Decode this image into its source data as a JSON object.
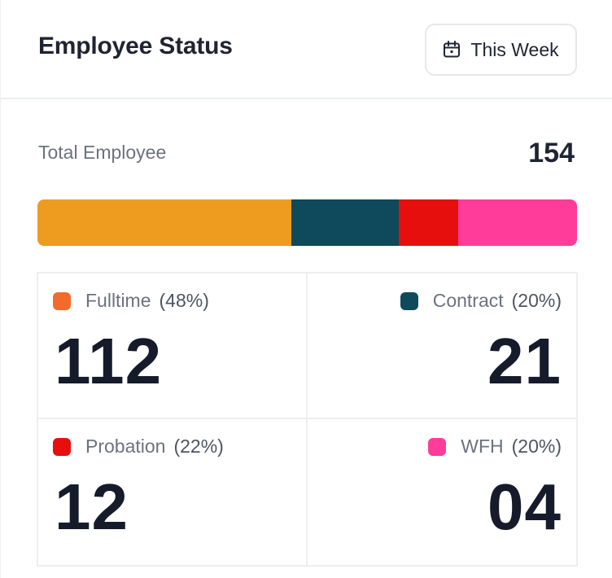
{
  "header": {
    "title": "Employee Status",
    "period_button": {
      "label": "This Week",
      "icon": "calendar-icon"
    }
  },
  "summary": {
    "total_label": "Total Employee",
    "total_value": "154"
  },
  "distribution_bar": {
    "segments": [
      {
        "name": "Fulltime",
        "fraction": 0.47,
        "color": "#ED9C1F"
      },
      {
        "name": "Contract",
        "fraction": 0.2,
        "color": "#0E4A5C"
      },
      {
        "name": "Probation",
        "fraction": 0.11,
        "color": "#E70E0E"
      },
      {
        "name": "WFH",
        "fraction": 0.22,
        "color": "#FF3C9A"
      }
    ]
  },
  "stats": [
    {
      "name": "Fulltime",
      "percent": "(48%)",
      "value": "112",
      "color": "#F26B2B"
    },
    {
      "name": "Contract",
      "percent": "(20%)",
      "value": "21",
      "color": "#0E4A5C"
    },
    {
      "name": "Probation",
      "percent": "(22%)",
      "value": "12",
      "color": "#E70E0E"
    },
    {
      "name": "WFH",
      "percent": "(20%)",
      "value": "04",
      "color": "#FF3C9A"
    }
  ]
}
